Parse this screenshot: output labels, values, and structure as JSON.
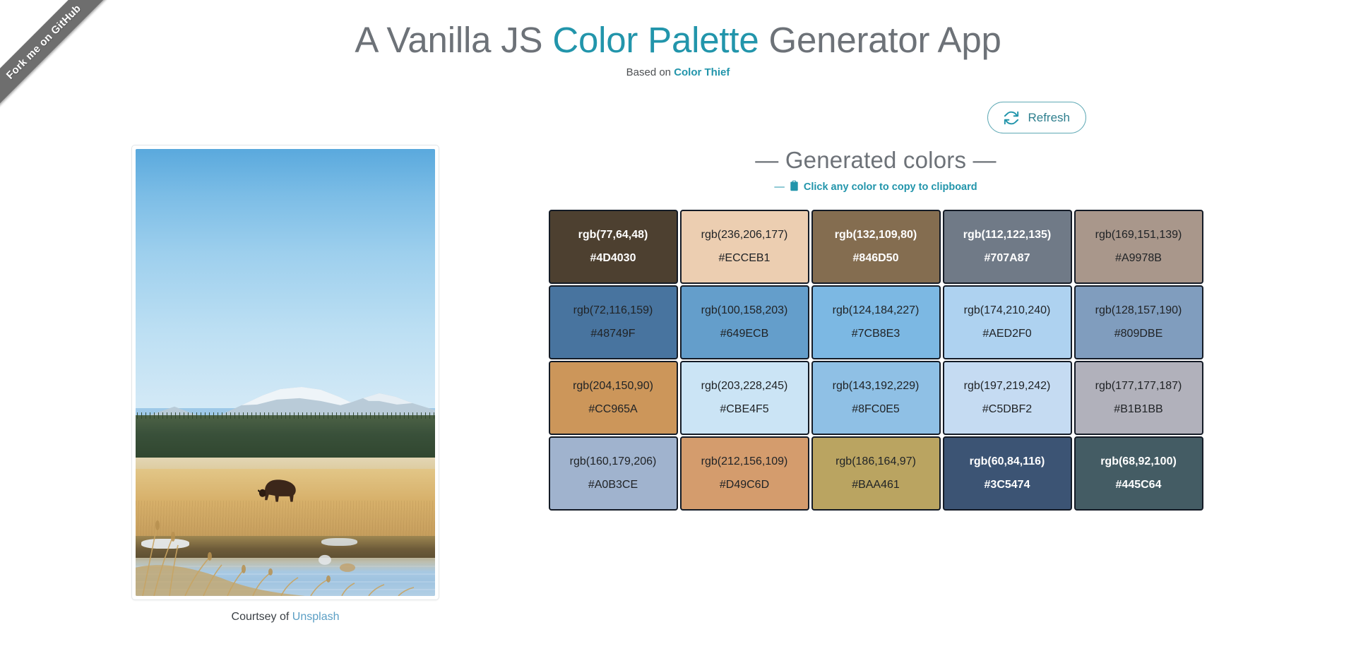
{
  "ribbon": {
    "label": "Fork me on GitHub"
  },
  "header": {
    "title_part1": "A Vanilla JS ",
    "title_accent": "Color Palette",
    "title_part2": " Generator App",
    "subtitle_prefix": "Based on ",
    "subtitle_link": "Color Thief"
  },
  "toolbar": {
    "refresh_label": "Refresh",
    "refresh_icon": "refresh-icon"
  },
  "photo": {
    "caption_prefix": "Courtsey of ",
    "caption_link": "Unsplash",
    "alt": "A lone bison standing in golden grass beside a river with forest and snow-capped mountains under a blue sky"
  },
  "palette": {
    "heading": "— Generated colors —",
    "hint_dash": "—",
    "hint_icon": "clipboard-icon",
    "hint_label": "Click any color to copy to clipboard",
    "accent_color": "#2295ab",
    "swatches": [
      {
        "rgb": "rgb(77,64,48)",
        "hex": "#4D4030",
        "text": "light"
      },
      {
        "rgb": "rgb(236,206,177)",
        "hex": "#ECCEB1",
        "text": "dark"
      },
      {
        "rgb": "rgb(132,109,80)",
        "hex": "#846D50",
        "text": "light"
      },
      {
        "rgb": "rgb(112,122,135)",
        "hex": "#707A87",
        "text": "light"
      },
      {
        "rgb": "rgb(169,151,139)",
        "hex": "#A9978B",
        "text": "dark"
      },
      {
        "rgb": "rgb(72,116,159)",
        "hex": "#48749F",
        "text": "dark"
      },
      {
        "rgb": "rgb(100,158,203)",
        "hex": "#649ECB",
        "text": "dark"
      },
      {
        "rgb": "rgb(124,184,227)",
        "hex": "#7CB8E3",
        "text": "dark"
      },
      {
        "rgb": "rgb(174,210,240)",
        "hex": "#AED2F0",
        "text": "dark"
      },
      {
        "rgb": "rgb(128,157,190)",
        "hex": "#809DBE",
        "text": "dark"
      },
      {
        "rgb": "rgb(204,150,90)",
        "hex": "#CC965A",
        "text": "dark"
      },
      {
        "rgb": "rgb(203,228,245)",
        "hex": "#CBE4F5",
        "text": "dark"
      },
      {
        "rgb": "rgb(143,192,229)",
        "hex": "#8FC0E5",
        "text": "dark"
      },
      {
        "rgb": "rgb(197,219,242)",
        "hex": "#C5DBF2",
        "text": "dark"
      },
      {
        "rgb": "rgb(177,177,187)",
        "hex": "#B1B1BB",
        "text": "dark"
      },
      {
        "rgb": "rgb(160,179,206)",
        "hex": "#A0B3CE",
        "text": "dark"
      },
      {
        "rgb": "rgb(212,156,109)",
        "hex": "#D49C6D",
        "text": "dark"
      },
      {
        "rgb": "rgb(186,164,97)",
        "hex": "#BAA461",
        "text": "dark"
      },
      {
        "rgb": "rgb(60,84,116)",
        "hex": "#3C5474",
        "text": "light"
      },
      {
        "rgb": "rgb(68,92,100)",
        "hex": "#445C64",
        "text": "light"
      }
    ]
  }
}
